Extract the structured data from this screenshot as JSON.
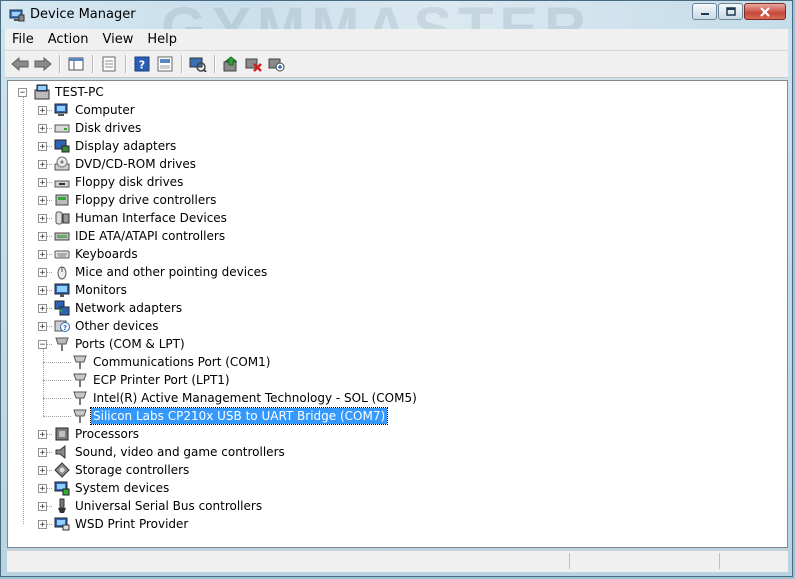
{
  "window": {
    "title": "Device Manager",
    "watermark": "GYMMASTER"
  },
  "menu": [
    {
      "label": "File"
    },
    {
      "label": "Action"
    },
    {
      "label": "View"
    },
    {
      "label": "Help"
    }
  ],
  "toolbar": {
    "buttons": [
      "back-arrow-icon",
      "forward-arrow-icon",
      "show-hide-console-tree-icon",
      "properties-icon",
      "help-icon",
      "show-hidden-icon",
      "update-driver-icon",
      "uninstall-icon",
      "scan-hardware-icon"
    ]
  },
  "tree": {
    "root": "TEST-PC",
    "categories": [
      {
        "label": "Computer",
        "icon": "computer-icon"
      },
      {
        "label": "Disk drives",
        "icon": "disk-drive-icon"
      },
      {
        "label": "Display adapters",
        "icon": "display-adapter-icon"
      },
      {
        "label": "DVD/CD-ROM drives",
        "icon": "dvd-drive-icon"
      },
      {
        "label": "Floppy disk drives",
        "icon": "floppy-disk-icon"
      },
      {
        "label": "Floppy drive controllers",
        "icon": "floppy-controller-icon"
      },
      {
        "label": "Human Interface Devices",
        "icon": "hid-icon"
      },
      {
        "label": "IDE ATA/ATAPI controllers",
        "icon": "ide-controller-icon"
      },
      {
        "label": "Keyboards",
        "icon": "keyboard-icon"
      },
      {
        "label": "Mice and other pointing devices",
        "icon": "mouse-icon"
      },
      {
        "label": "Monitors",
        "icon": "monitor-icon"
      },
      {
        "label": "Network adapters",
        "icon": "network-adapter-icon"
      },
      {
        "label": "Other devices",
        "icon": "unknown-device-icon"
      },
      {
        "label": "Ports (COM & LPT)",
        "icon": "port-icon",
        "expanded": true,
        "children": [
          {
            "label": "Communications Port (COM1)"
          },
          {
            "label": "ECP Printer Port (LPT1)"
          },
          {
            "label": "Intel(R) Active Management Technology - SOL (COM5)"
          },
          {
            "label": "Silicon Labs CP210x USB to UART Bridge (COM7)",
            "selected": true
          }
        ]
      },
      {
        "label": "Processors",
        "icon": "processor-icon"
      },
      {
        "label": "Sound, video and game controllers",
        "icon": "sound-icon"
      },
      {
        "label": "Storage controllers",
        "icon": "storage-controller-icon"
      },
      {
        "label": "System devices",
        "icon": "system-device-icon"
      },
      {
        "label": "Universal Serial Bus controllers",
        "icon": "usb-icon"
      },
      {
        "label": "WSD Print Provider",
        "icon": "wsd-print-icon"
      }
    ]
  },
  "colors": {
    "selection": "#3399ff",
    "window_frame": "#b9d3e2"
  }
}
